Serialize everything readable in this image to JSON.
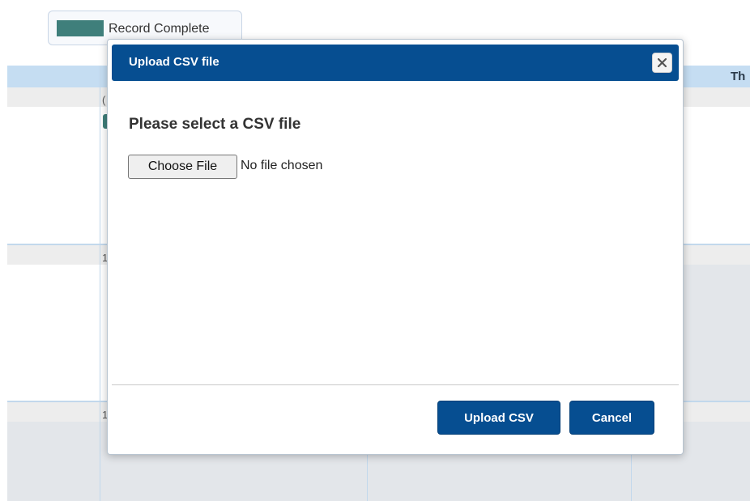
{
  "legend": {
    "label": "Record Complete",
    "swatch_color": "#3f7f7b"
  },
  "calendar": {
    "visible_day_header": "Th",
    "date_fragments": [
      "(",
      "1",
      "1"
    ]
  },
  "modal": {
    "title": "Upload CSV file",
    "close_icon": "close-icon",
    "heading": "Please select a CSV file",
    "file_input": {
      "button_label": "Choose File",
      "status": "No file chosen"
    },
    "buttons": {
      "upload_label": "Upload CSV",
      "cancel_label": "Cancel"
    },
    "accent_color": "#064e91"
  }
}
